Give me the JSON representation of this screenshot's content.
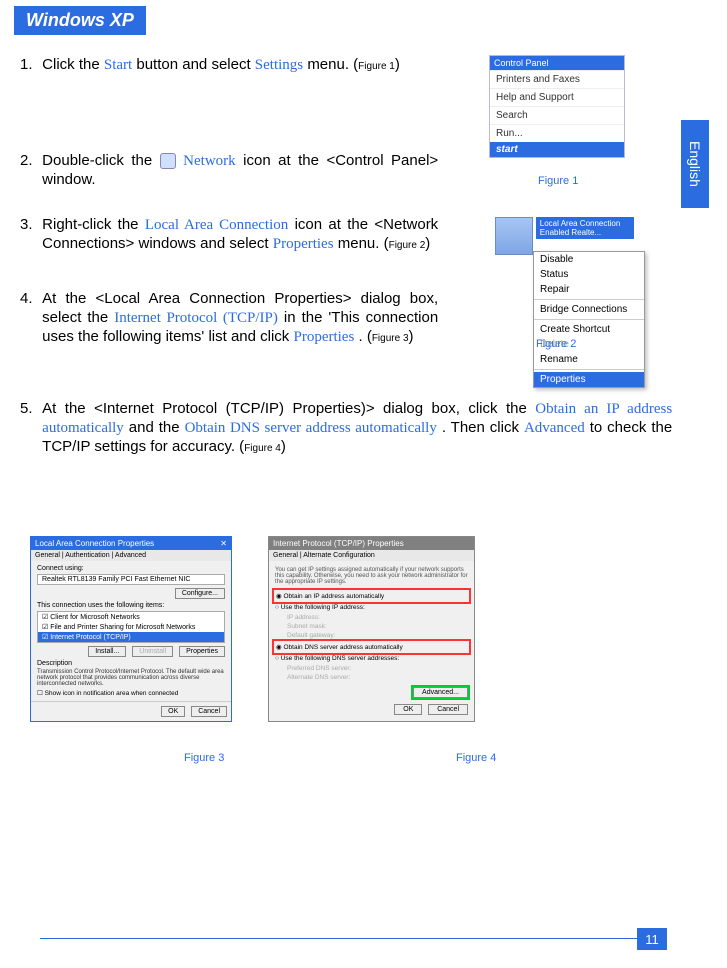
{
  "section_header": "Windows XP",
  "side_tab": "English",
  "steps": {
    "s1": {
      "num": "1.",
      "t1": "Click the ",
      "start": "Start",
      "t2": " button and select ",
      "settings": "Settings",
      "t3": " menu. (",
      "fig": "Figure 1",
      "t4": ")"
    },
    "s2": {
      "num": "2.",
      "t1": "Double-click the ",
      "network": "Network",
      "t2": " icon at the <Control Panel> window."
    },
    "s3": {
      "num": "3.",
      "t1": "Right-click the ",
      "lac": "Local Area Connection",
      "t2": " icon at the <Network Connections> windows and select ",
      "props": "Properties",
      "t3": " menu. (",
      "fig": "Figure 2",
      "t4": ")"
    },
    "s4": {
      "num": "4.",
      "t1": "At the <Local Area Connection Properties> dialog box, select the ",
      "ip": "Internet Protocol (TCP/IP)",
      "t2": " in the 'This connection uses the following items' list and click ",
      "props": "Properties",
      "t3": ". (",
      "fig": "Figure 3",
      "t4": ")"
    },
    "s5": {
      "num": "5.",
      "t1": "At the <Internet Protocol (TCP/IP) Properties)> dialog box, click the ",
      "obtip": "Obtain an IP address automatically",
      "t2": " and the ",
      "obtdns": "Obtain DNS server address automatically",
      "t3": ". Then click ",
      "adv": "Advanced",
      "t4": " to check the TCP/IP settings for accuracy. (",
      "fig": "Figure 4",
      "t5": ")"
    }
  },
  "fig1": {
    "caption": "Figure 1",
    "title": "Control Panel",
    "rows": [
      "Printers and Faxes",
      "Help and Support",
      "Search",
      "Run..."
    ],
    "start": "start"
  },
  "fig2": {
    "caption": "Figure 2",
    "sel": "Local Area Connection\nEnabled\nRealte...",
    "menu": {
      "disable": "Disable",
      "status": "Status",
      "repair": "Repair",
      "bridge": "Bridge Connections",
      "shortcut": "Create Shortcut",
      "delete": "Delete",
      "rename": "Rename",
      "props": "Properties"
    }
  },
  "fig3": {
    "caption": "Figure 3",
    "title": "Local Area Connection Properties",
    "tabs": "General | Authentication | Advanced",
    "connect_using": "Connect using:",
    "adapter": "Realtek RTL8139 Family PCI Fast Ethernet NIC",
    "configure": "Configure...",
    "uses": "This connection uses the following items:",
    "items": [
      "Client for Microsoft Networks",
      "File and Printer Sharing for Microsoft Networks",
      "Internet Protocol (TCP/IP)"
    ],
    "install": "Install...",
    "uninstall": "Uninstall",
    "properties": "Properties",
    "desc_h": "Description",
    "desc": "Transmission Control Protocol/Internet Protocol. The default wide area network protocol that provides communication across diverse interconnected networks.",
    "show_icon": "Show icon in notification area when connected",
    "ok": "OK",
    "cancel": "Cancel"
  },
  "fig4": {
    "caption": "Figure 4",
    "title": "Internet Protocol (TCP/IP) Properties",
    "tabs": "General | Alternate Configuration",
    "note": "You can get IP settings assigned automatically if your network supports this capability. Otherwise, you need to ask your network administrator for the appropriate IP settings.",
    "r1": "Obtain an IP address automatically",
    "r2": "Use the following IP address:",
    "f_ip": "IP address:",
    "f_mask": "Subnet mask:",
    "f_gw": "Default gateway:",
    "r3": "Obtain DNS server address automatically",
    "r4": "Use the following DNS server addresses:",
    "f_pdns": "Preferred DNS server:",
    "f_adns": "Alternate DNS server:",
    "advanced": "Advanced...",
    "ok": "OK",
    "cancel": "Cancel"
  },
  "page_number": "11"
}
